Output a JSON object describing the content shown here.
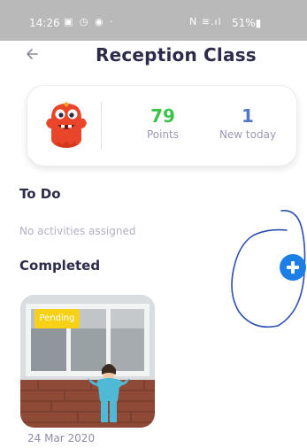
{
  "status_bar": {
    "time": "14:26",
    "left_icons": "▣ ◷ ◉ ·",
    "right_icons": "N ≋.ıl",
    "battery": "51%▮"
  },
  "header": {
    "back_icon": "arrow-left-icon",
    "title": "Reception Class"
  },
  "stats": {
    "points_value": "79",
    "points_label": "Points",
    "new_value": "1",
    "new_label": "New today"
  },
  "todo": {
    "heading": "To Do",
    "empty_text": "No activities assigned"
  },
  "completed": {
    "heading": "Completed",
    "items": [
      {
        "badge": "Pending",
        "date": "24 Mar 2020"
      }
    ]
  },
  "colors": {
    "points": "#3ec24a",
    "new_today": "#4f78c7",
    "add_button": "#1d7fe5",
    "pending_badge": "#f6d117",
    "ink": "#2a4fb0"
  }
}
